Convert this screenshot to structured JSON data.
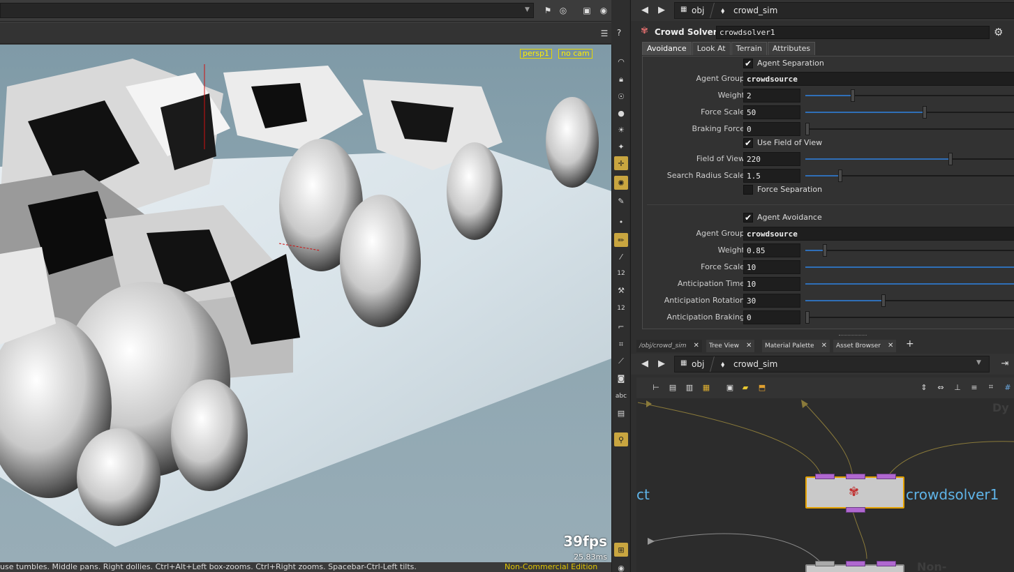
{
  "viewport": {
    "camera_menu": "persp1",
    "cam_menu": "no cam",
    "fps": "39fps",
    "frame_ms": "25.83ms",
    "status_hint": "use tumbles. Middle pans. Right dollies. Ctrl+Alt+Left box-zooms. Ctrl+Right zooms. Spacebar-Ctrl-Left tilts.",
    "edition": "Non-Commercial Edition"
  },
  "param_path": {
    "root": "obj",
    "network": "crowd_sim"
  },
  "node": {
    "type_label": "Crowd Solver",
    "name": "crowdsolver1"
  },
  "tabs": [
    "Avoidance",
    "Look At",
    "Terrain",
    "Attributes"
  ],
  "separation": {
    "toggle_label": "Agent Separation",
    "agent_group_label": "Agent Group",
    "agent_group": "crowdsource",
    "weight_label": "Weight",
    "weight": "2",
    "weight_frac": 0.22,
    "force_scale_label": "Force Scale",
    "force_scale": "50",
    "force_scale_frac": 0.55,
    "braking_label": "Braking Force",
    "braking": "0",
    "braking_frac": 0.0,
    "fov_toggle_label": "Use Field of View",
    "fov_label": "Field of View",
    "fov": "220",
    "fov_frac": 0.67,
    "search_label": "Search Radius Scale",
    "search": "1.5",
    "search_frac": 0.16,
    "force_sep_label": "Force Separation"
  },
  "avoidance": {
    "toggle_label": "Agent Avoidance",
    "agent_group_label": "Agent Group",
    "agent_group": "crowdsource",
    "weight_label": "Weight",
    "weight": "0.85",
    "weight_frac": 0.09,
    "force_scale_label": "Force Scale",
    "force_scale": "10",
    "force_scale_frac": 1.0,
    "anticipation_time_label": "Anticipation Time",
    "anticipation_time": "10",
    "anticipation_time_frac": 1.0,
    "anticipation_rotation_label": "Anticipation Rotation",
    "anticipation_rotation": "30",
    "anticipation_rotation_frac": 0.36,
    "anticipation_braking_label": "Anticipation Braking",
    "anticipation_braking": "0",
    "anticipation_braking_frac": 0.0
  },
  "net_tabs": [
    "/obj/crowd_sim",
    "Tree View",
    "Material Palette",
    "Asset Browser"
  ],
  "net_path": {
    "root": "obj",
    "network": "crowd_sim"
  },
  "network": {
    "node_label": "crowdsolver1",
    "left_label": "ct",
    "faint_top": "Dy",
    "faint_bottom": "Non-Commercial"
  },
  "colors": {
    "accent": "#e4a100",
    "node_label": "#5fb4e8",
    "overlay": "#ffef00",
    "slider": "#2f6fb8"
  },
  "vtool_icons": [
    "eye-icon",
    "lock-icon",
    "skull-icon",
    "sphere-icon",
    "light-icon",
    "bone-icon",
    "target-icon",
    "pose-icon",
    "dot-icon",
    "brush-icon",
    "pen-icon",
    "number-icon",
    "hammer-icon",
    "ruler-icon",
    "corner-icon",
    "grid-icon",
    "knife-icon",
    "stack-icon",
    "text-icon",
    "photo-icon",
    "pin-icon"
  ],
  "vtool_text": {
    "twelve_a": "12",
    "twelve_b": "12",
    "abc": "abc"
  }
}
